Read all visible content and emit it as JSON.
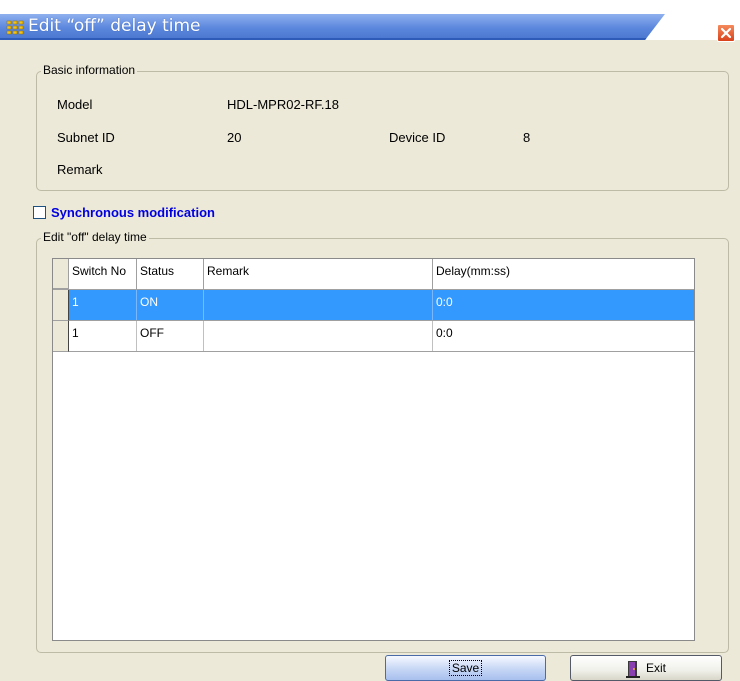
{
  "window": {
    "title": "Edit “off” delay time",
    "icon": "grid-dots-icon",
    "close_icon": "close-icon"
  },
  "basic_info": {
    "legend": "Basic information",
    "model_label": "Model",
    "model_value": "HDL-MPR02-RF.18",
    "subnet_label": "Subnet ID",
    "subnet_value": "20",
    "device_label": "Device ID",
    "device_value": "8",
    "remark_label": "Remark"
  },
  "sync": {
    "label": "Synchronous modification",
    "checked": false
  },
  "delay_group": {
    "legend": "Edit \"off\" delay time",
    "columns": [
      "Switch No",
      "Status",
      "Remark",
      "Delay(mm:ss)"
    ],
    "rows": [
      {
        "switch_no": "1",
        "status": "ON",
        "remark": "",
        "delay": "0:0",
        "selected": true
      },
      {
        "switch_no": "1",
        "status": "OFF",
        "remark": "",
        "delay": "0:0",
        "selected": false
      }
    ]
  },
  "buttons": {
    "save": "Save",
    "exit": "Exit",
    "exit_icon": "door-exit-icon"
  },
  "colors": {
    "title_bar": "#5a86dc",
    "selection": "#3399ff",
    "close": "#d9421b",
    "sync_label": "#0000e0"
  }
}
